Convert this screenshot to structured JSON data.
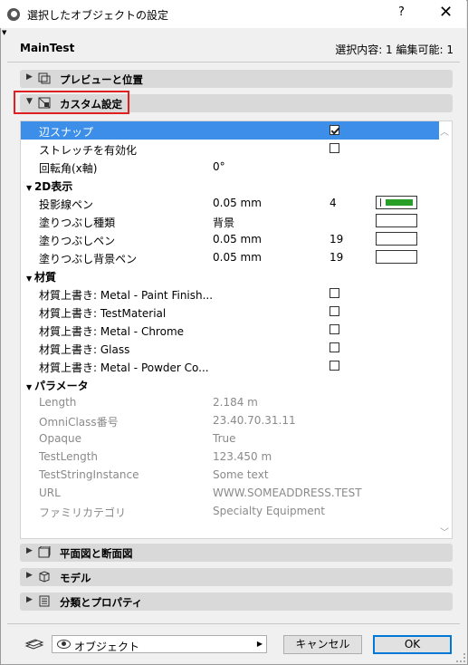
{
  "window": {
    "title": "選択したオブジェクトの設定",
    "help_label": "?",
    "close_label": "✕"
  },
  "header": {
    "object_name": "MainTest",
    "selection_info": "選択内容: 1 編集可能: 1"
  },
  "sections": {
    "preview": "プレビューと位置",
    "custom": "カスタム設定",
    "floorplan": "平面図と断面図",
    "model": "モデル",
    "classification": "分類とプロパティ"
  },
  "settings": {
    "edge_snap": {
      "label": "辺スナップ",
      "checked": true
    },
    "stretch": {
      "label": "ストレッチを有効化",
      "checked": false
    },
    "rotation": {
      "label": "回転角(x軸)",
      "value": "0°"
    },
    "group_2d": "2D表示",
    "projection_pen": {
      "label": "投影線ペン",
      "value": "0.05 mm",
      "pen": "4",
      "pen_color": "#28a028"
    },
    "fill_type": {
      "label": "塗りつぶし種類",
      "value": "背景"
    },
    "fill_pen": {
      "label": "塗りつぶしペン",
      "value": "0.05 mm",
      "pen": "19"
    },
    "fill_bg_pen": {
      "label": "塗りつぶし背景ペン",
      "value": "0.05 mm",
      "pen": "19"
    },
    "group_material": "材質",
    "materials": [
      "材質上書き: Metal - Paint Finish...",
      "材質上書き: TestMaterial",
      "材質上書き: Metal - Chrome",
      "材質上書き: Glass",
      "材質上書き: Metal - Powder Co..."
    ],
    "group_params": "パラメータ",
    "params": [
      {
        "name": "Length",
        "value": "2.184 m"
      },
      {
        "name": "OmniClass番号",
        "value": "23.40.70.31.11"
      },
      {
        "name": "Opaque",
        "value": "True"
      },
      {
        "name": "TestLength",
        "value": "123.450 m"
      },
      {
        "name": "TestStringInstance",
        "value": "Some text"
      },
      {
        "name": "URL",
        "value": "WWW.SOMEADDRESS.TEST"
      },
      {
        "name": "ファミリカテゴリ",
        "value": "Specialty Equipment"
      }
    ]
  },
  "footer": {
    "layer_combo": "オブジェクト",
    "cancel_label": "キャンセル",
    "ok_label": "OK"
  },
  "colors": {
    "selection": "#3c8ee8",
    "highlight_box": "#e02020",
    "pen_green": "#28a028"
  }
}
